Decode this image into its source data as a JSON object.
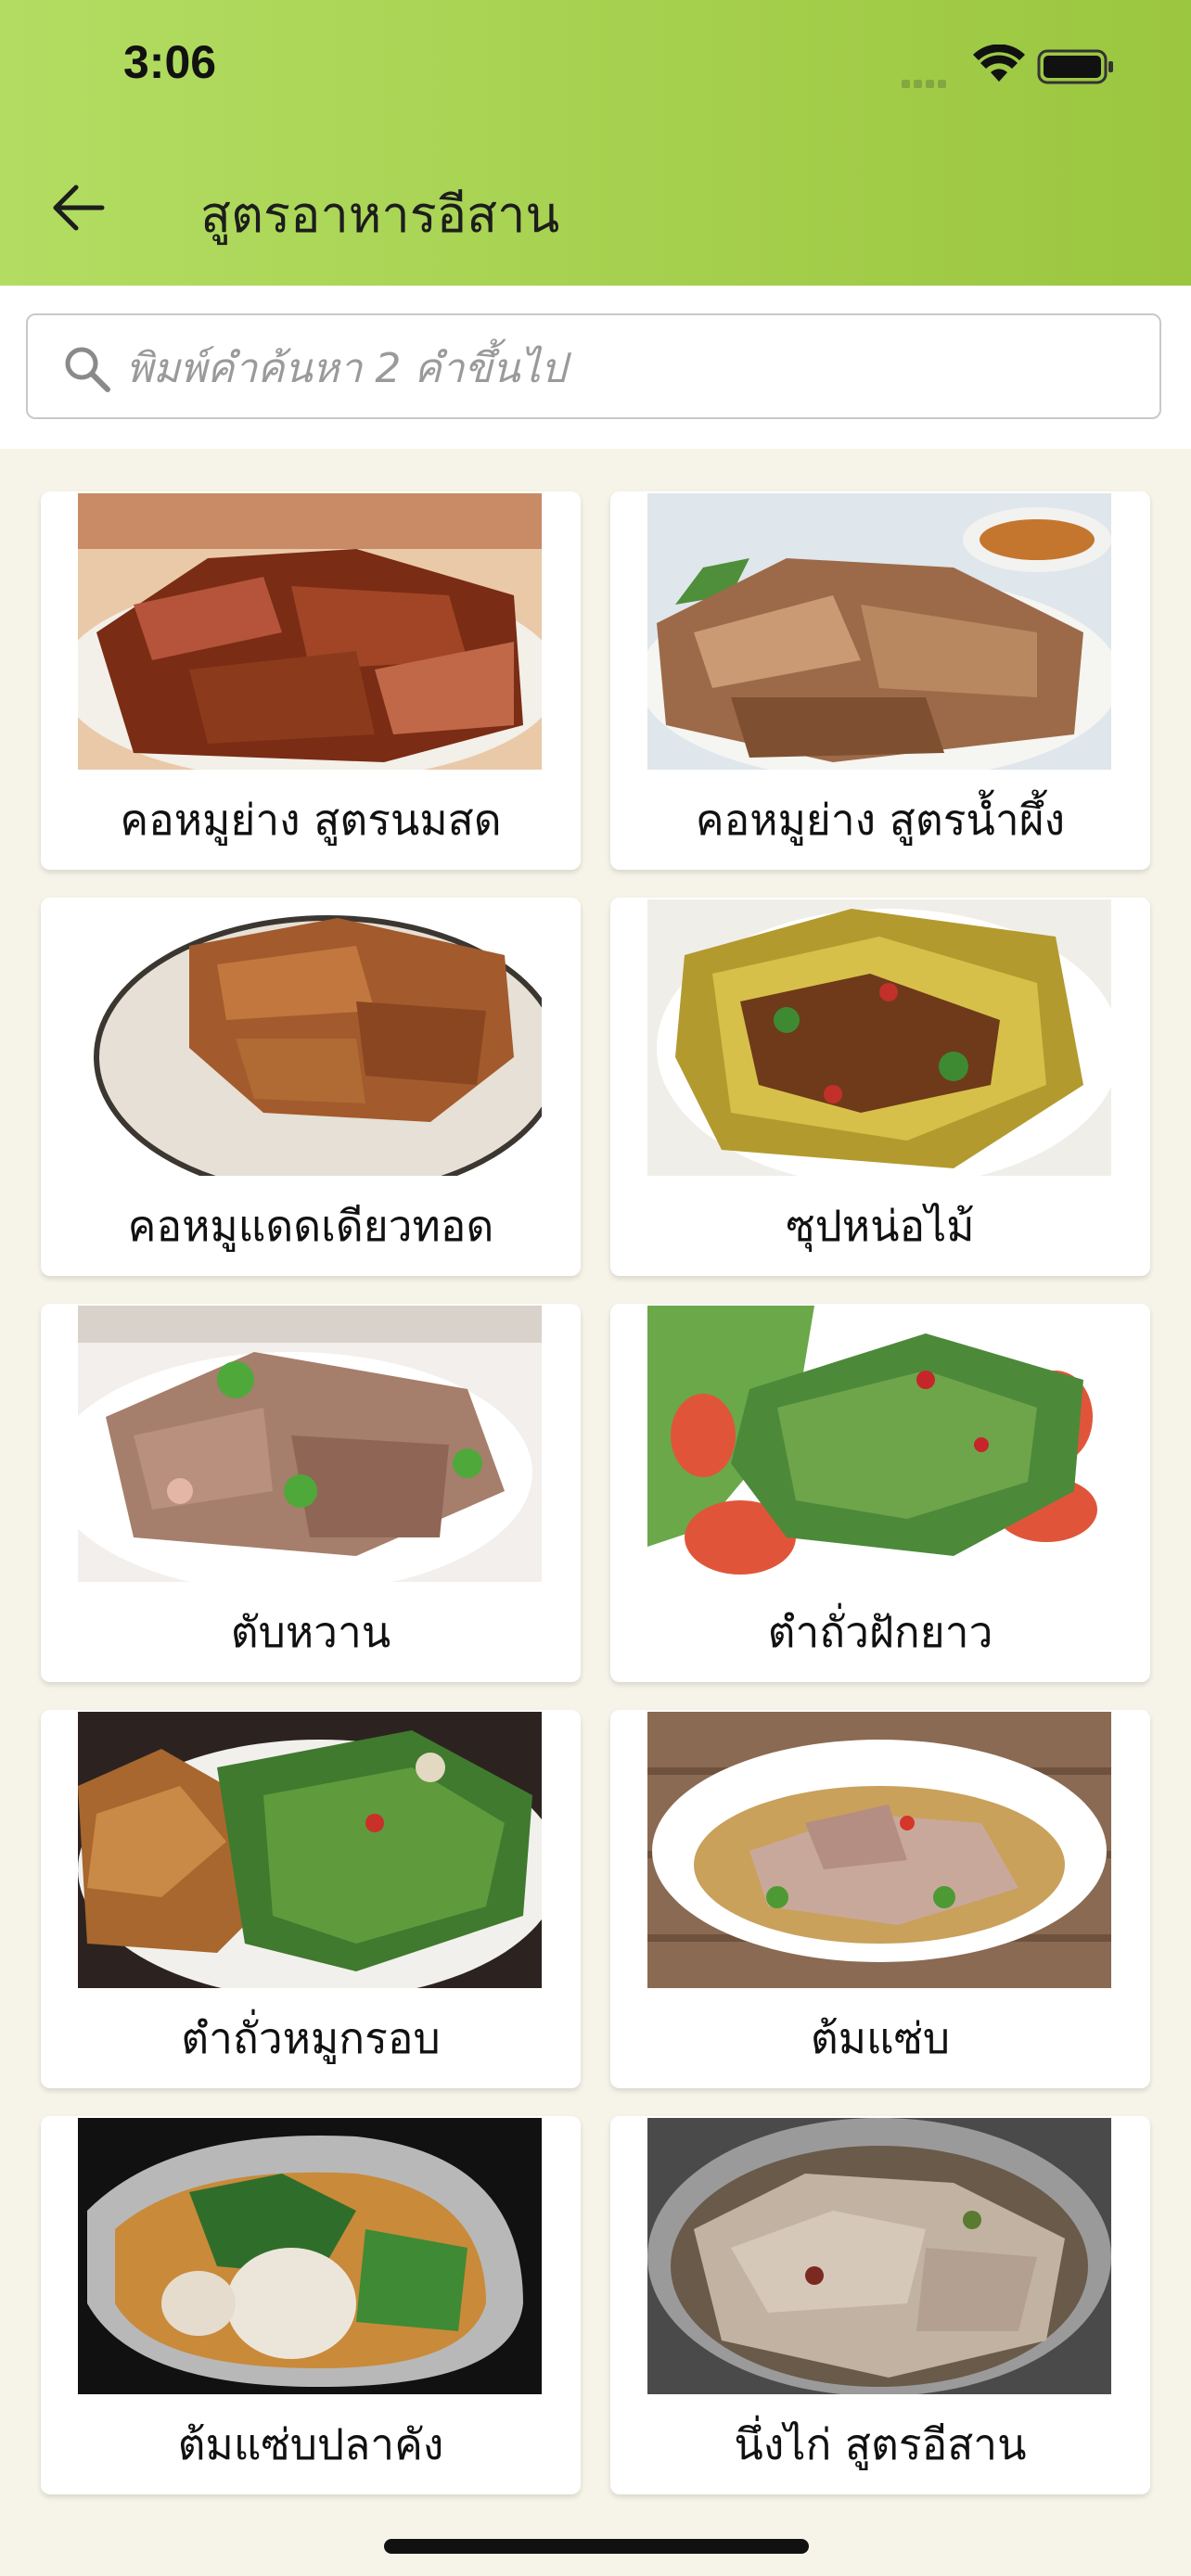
{
  "status_bar": {
    "time": "3:06"
  },
  "header": {
    "title": "สูตรอาหารอีสาน"
  },
  "search": {
    "placeholder": "พิมพ์คำค้นหา 2 คำขึ้นไป",
    "value": ""
  },
  "recipes": [
    {
      "label": "คอหมูย่าง สูตรนมสด"
    },
    {
      "label": "คอหมูย่าง สูตรน้ำผึ้ง"
    },
    {
      "label": "คอหมูแดดเดียวทอด"
    },
    {
      "label": "ซุปหน่อไม้"
    },
    {
      "label": "ตับหวาน"
    },
    {
      "label": "ตำถั่วฝักยาว"
    },
    {
      "label": "ตำถั่วหมูกรอบ"
    },
    {
      "label": "ต้มแซ่บ"
    },
    {
      "label": "ต้มแซ่บปลาคัง"
    },
    {
      "label": "นึ่งไก่ สูตรอีสาน"
    }
  ],
  "colors": {
    "appbar_start": "#b2dd62",
    "appbar_end": "#9bc63f",
    "page_background": "#f6f4e8"
  },
  "icons": [
    "back-arrow-icon",
    "search-icon",
    "wifi-icon",
    "battery-icon"
  ]
}
